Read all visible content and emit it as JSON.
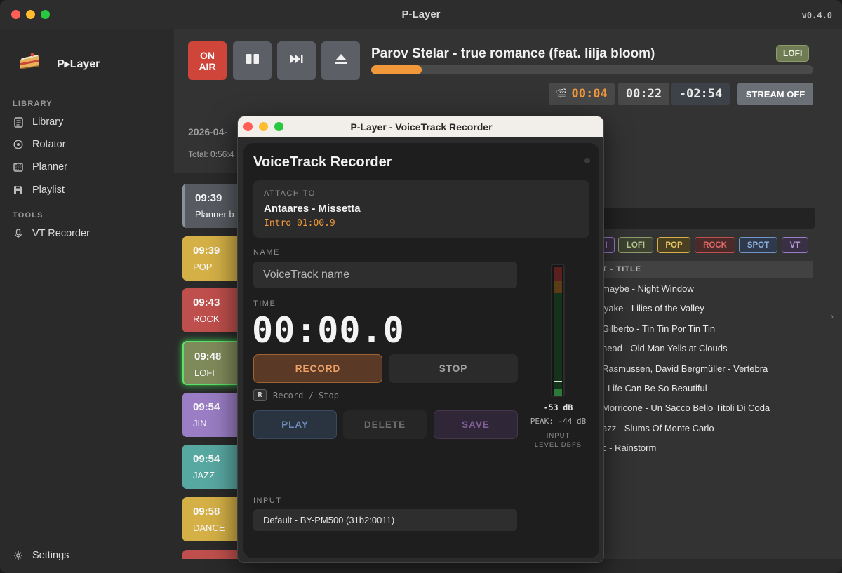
{
  "app": {
    "title": "P-Layer",
    "version": "v0.4.0",
    "brand": "P▸Layer"
  },
  "sidebar": {
    "library_section": "LIBRARY",
    "items": [
      {
        "label": "Library",
        "icon": "document-icon"
      },
      {
        "label": "Rotator",
        "icon": "rotator-icon"
      },
      {
        "label": "Planner",
        "icon": "calendar-icon"
      },
      {
        "label": "Playlist",
        "icon": "floppy-icon"
      }
    ],
    "tools_section": "TOOLS",
    "tools": [
      {
        "label": "VT Recorder",
        "icon": "microphone-icon"
      }
    ],
    "settings_label": "Settings"
  },
  "player": {
    "on_air_line1": "ON",
    "on_air_line2": "AIR",
    "now_playing": "Parov Stelar - true romance (feat. lilja bloom)",
    "genre_badge": "LOFI",
    "progress_percent": 11.5,
    "elapsed": "00:04",
    "duration": "00:22",
    "remaining": "-02:54",
    "stream_label": "STREAM OFF",
    "accent_color": "#f0983a",
    "on_air_color": "#d0453a"
  },
  "planner": {
    "date": "2026-04-",
    "total": "Total: 0:56:4",
    "cards": [
      {
        "time": "09:39",
        "label": "Planner b",
        "color": "#575b61"
      },
      {
        "time": "09:39",
        "label": "POP",
        "color": "#d4b046"
      },
      {
        "time": "09:43",
        "label": "ROCK",
        "color": "#bf4f4c"
      },
      {
        "time": "09:48",
        "label": "LOFI",
        "color": "#7f8a5a"
      },
      {
        "time": "09:54",
        "label": "JIN",
        "color": "#9a7dc4"
      },
      {
        "time": "09:54",
        "label": "JAZZ",
        "color": "#58a8a2"
      },
      {
        "time": "09:58",
        "label": "DANCE",
        "color": "#d4b046"
      }
    ]
  },
  "playlist": {
    "tags": [
      {
        "label": "I",
        "color": "#9a7dc4"
      },
      {
        "label": "LOFI",
        "color": "#8e9b6b"
      },
      {
        "label": "POP",
        "color": "#d4b046"
      },
      {
        "label": "ROCK",
        "color": "#bf4f4c"
      },
      {
        "label": "SPOT",
        "color": "#6f95c8"
      },
      {
        "label": "VT",
        "color": "#9a7dc4"
      }
    ],
    "header": "T - TITLE",
    "rows": [
      "maybe - Night Window",
      "iyake - Lilies of the Valley",
      "Gilberto - Tin Tin Por Tin Tin",
      "head - Old Man Yells at Clouds",
      "Rasmussen, David Bergmüller - Vertebra",
      "- Life Can Be So Beautiful",
      "Morricone - Un Sacco Bello Titoli Di Coda",
      "azz - Slums Of Monte Carlo",
      "c - Rainstorm"
    ]
  },
  "recorder": {
    "window_title": "P-Layer - VoiceTrack Recorder",
    "heading": "VoiceTrack Recorder",
    "attach_label": "ATTACH TO",
    "attach_name": "Antaares - Missetta",
    "attach_intro": "Intro 01:00.9",
    "name_label": "NAME",
    "name_placeholder": "VoiceTrack name",
    "time_label": "TIME",
    "time_value": "00:00.0",
    "record_label": "RECORD",
    "stop_label": "STOP",
    "hint_key": "R",
    "hint_text": "Record / Stop",
    "play_label": "PLAY",
    "delete_label": "DELETE",
    "save_label": "SAVE",
    "level_db": "-53 dB",
    "peak": "PEAK: -44 dB",
    "meter_caption_1": "INPUT",
    "meter_caption_2": "LEVEL DBFS",
    "input_label": "INPUT",
    "input_device": "Default - BY-PM500 (31b2:0011)"
  }
}
